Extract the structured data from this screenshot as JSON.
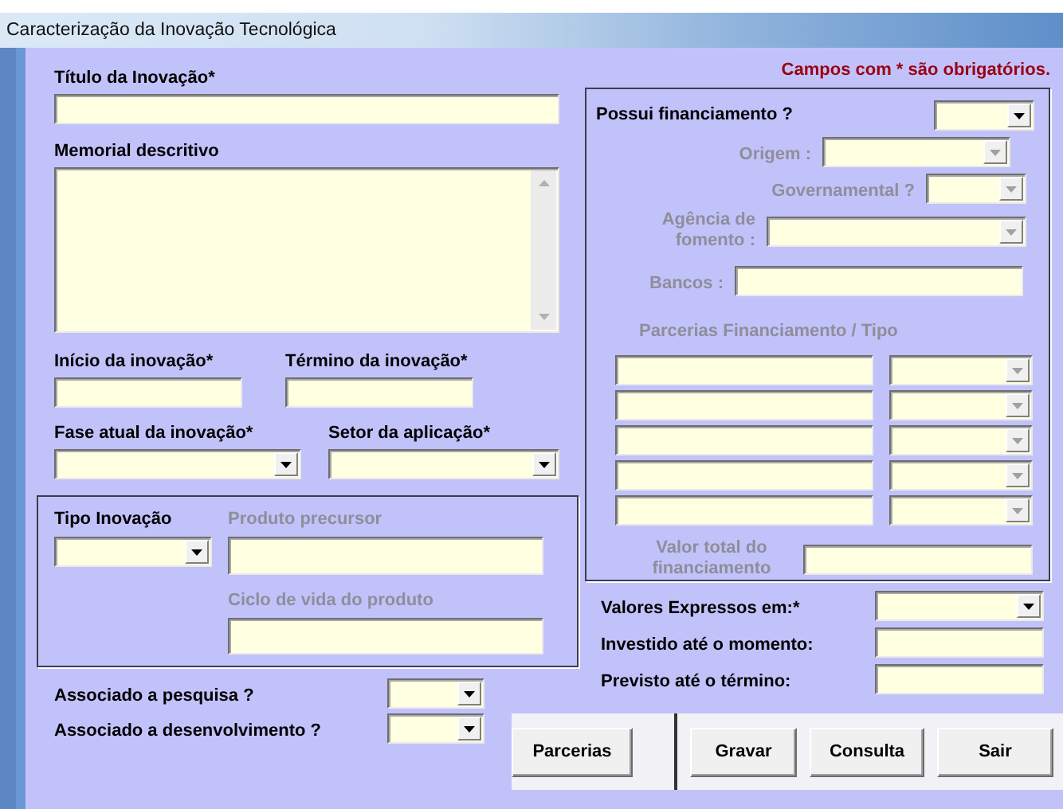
{
  "window": {
    "title": "Caracterização da Inovação Tecnológica"
  },
  "required_note": "Campos com * são obrigatórios.",
  "title_field": {
    "label": "Título da Inovação*"
  },
  "description": {
    "label": "Memorial descritivo"
  },
  "dates": [
    {
      "label": "Início da inovação*"
    },
    {
      "label": "Término da inovação*"
    }
  ],
  "selects": [
    {
      "label": "Fase atual da inovação*"
    },
    {
      "label": "Setor da aplicação*"
    }
  ],
  "innovation_type": {
    "label": "Tipo Inovação",
    "precursor": {
      "label": "Produto precursor",
      "disabled": true
    },
    "lifecycle": {
      "label": "Ciclo de vida do produto",
      "disabled": true
    }
  },
  "associations": [
    {
      "label": "Associado a pesquisa ?"
    },
    {
      "label": "Associado a desenvolvimento ?"
    }
  ],
  "financing": {
    "label": "Possui financiamento ?",
    "fields": [
      {
        "kind": "select",
        "label": "Origem :",
        "disabled": true
      },
      {
        "kind": "select",
        "label": "Governamental ?",
        "disabled": true
      },
      {
        "kind": "select",
        "label": "Agência de fomento :",
        "disabled": true
      },
      {
        "kind": "text",
        "label": "Bancos :",
        "disabled": true
      }
    ],
    "partners_heading": {
      "label": "Parcerias Financiamento  /  Tipo",
      "disabled": true
    },
    "partner_rows": [
      {
        "disabled": true
      },
      {
        "disabled": true
      },
      {
        "disabled": true
      },
      {
        "disabled": true
      },
      {
        "disabled": true
      }
    ],
    "total": {
      "label": "Valor total do financiamento",
      "disabled": true
    }
  },
  "values": [
    {
      "kind": "select",
      "label": "Valores Expressos em:*"
    },
    {
      "kind": "text",
      "label": "Investido até o momento:"
    },
    {
      "kind": "text",
      "label": "Previsto até o término:"
    }
  ],
  "buttons": [
    "Parcerias",
    "Gravar",
    "Consulta",
    "Sair"
  ]
}
